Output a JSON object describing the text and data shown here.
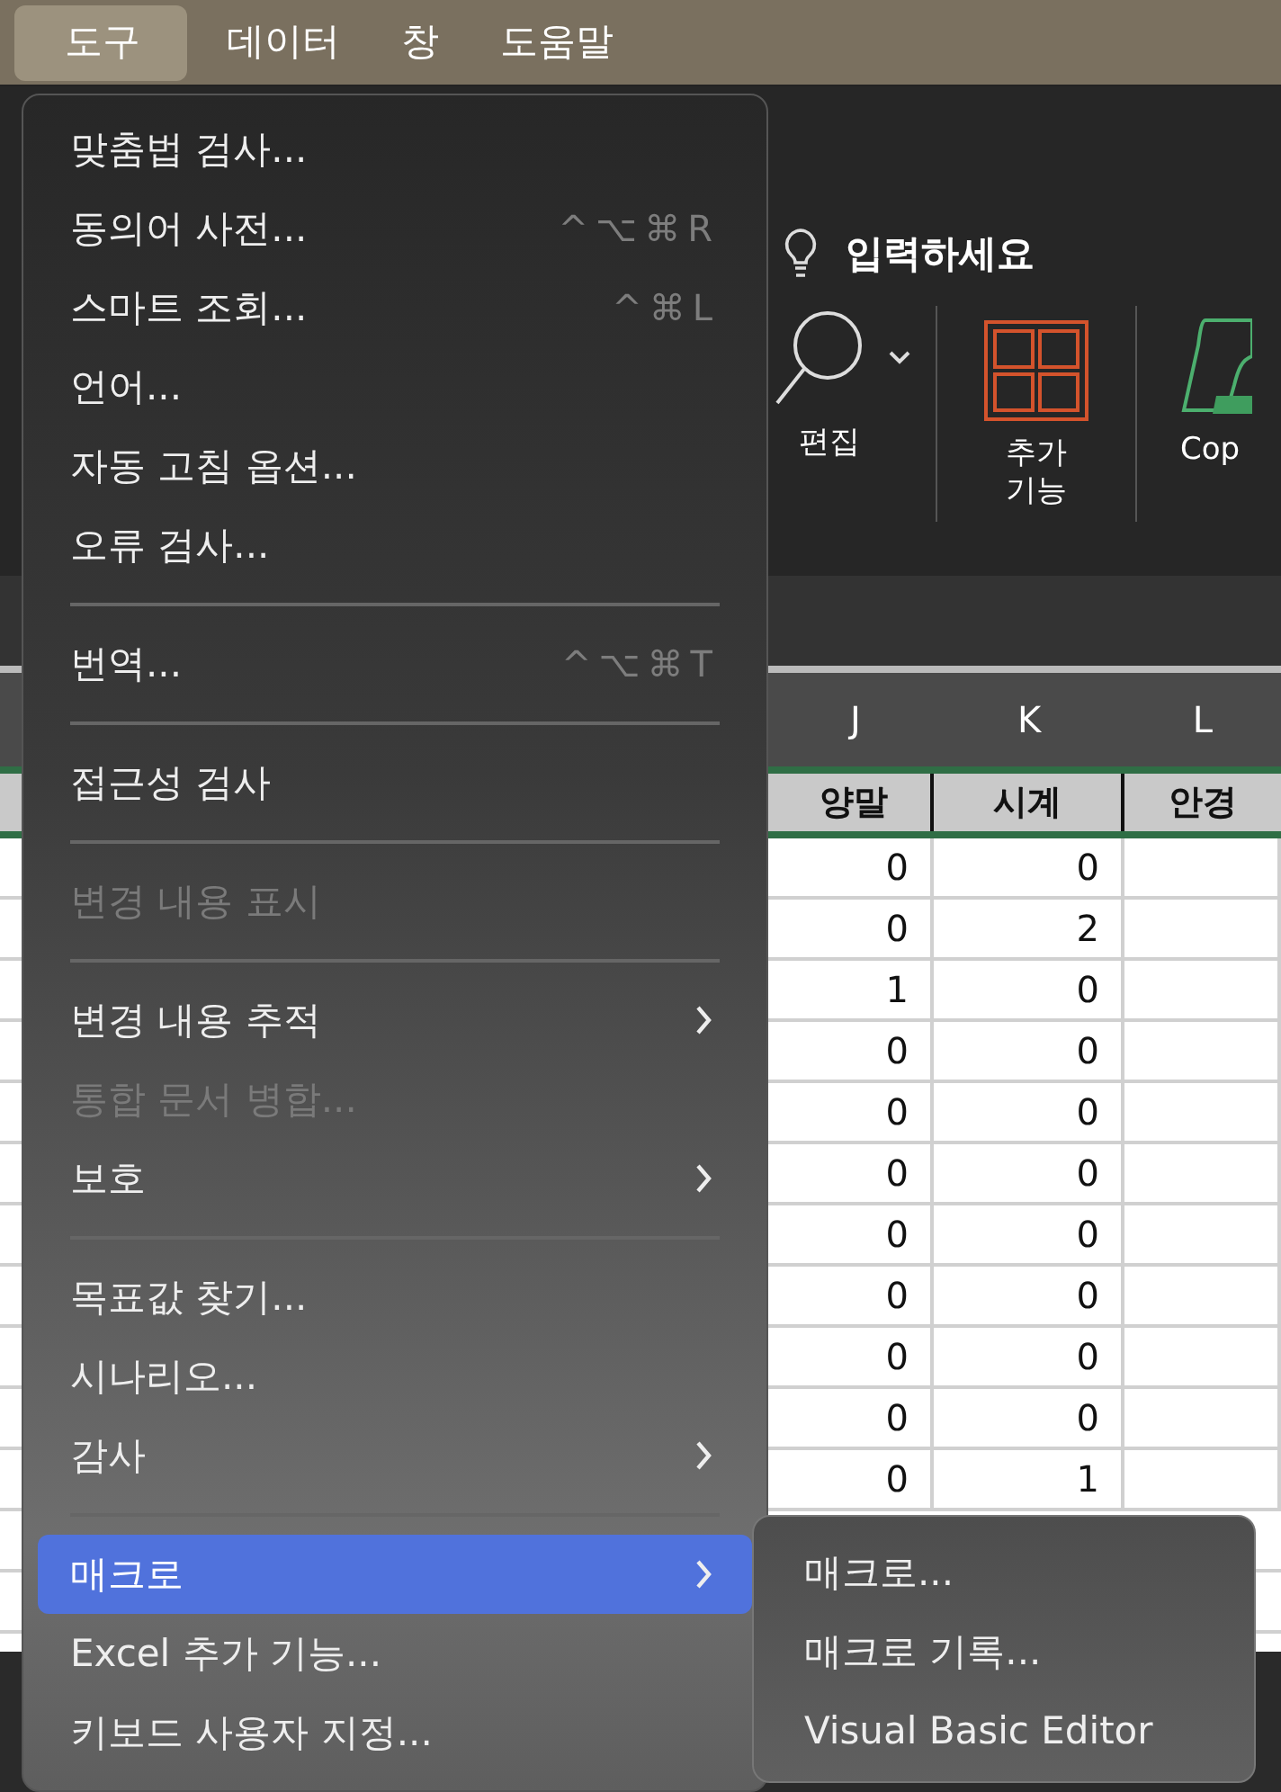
{
  "menu_bar": [
    {
      "label": "도구",
      "selected": true
    },
    {
      "label": "데이터",
      "selected": false
    },
    {
      "label": "창",
      "selected": false
    },
    {
      "label": "도움말",
      "selected": false
    }
  ],
  "ribbon": {
    "search_hint": "입력하세요",
    "groups": [
      {
        "kind": "find",
        "label": "편집"
      },
      {
        "kind": "addins",
        "label": "추가 기능"
      },
      {
        "kind": "copilot",
        "label": "Cop"
      }
    ]
  },
  "sheet": {
    "column_letters": [
      "J",
      "K",
      "L"
    ],
    "header_cells": [
      "양말",
      "시계",
      "안경"
    ],
    "rows": [
      [
        "0",
        "0"
      ],
      [
        "0",
        "2"
      ],
      [
        "1",
        "0"
      ],
      [
        "0",
        "0"
      ],
      [
        "0",
        "0"
      ],
      [
        "0",
        "0"
      ],
      [
        "0",
        "0"
      ],
      [
        "0",
        "0"
      ],
      [
        "0",
        "0"
      ],
      [
        "0",
        "0"
      ],
      [
        "0",
        "1"
      ]
    ]
  },
  "menu": {
    "items": [
      {
        "kind": "item",
        "label": "맞춤법 검사...",
        "disabled": false,
        "selected": false,
        "submenu": false
      },
      {
        "kind": "item",
        "label": "동의어 사전...",
        "shortcut": "^⌥⌘R",
        "disabled": false,
        "selected": false,
        "submenu": false
      },
      {
        "kind": "item",
        "label": "스마트 조회...",
        "shortcut": "^⌘L",
        "disabled": false,
        "selected": false,
        "submenu": false
      },
      {
        "kind": "item",
        "label": "언어...",
        "disabled": false,
        "selected": false,
        "submenu": false
      },
      {
        "kind": "item",
        "label": "자동 고침 옵션...",
        "disabled": false,
        "selected": false,
        "submenu": false
      },
      {
        "kind": "item",
        "label": "오류 검사...",
        "disabled": false,
        "selected": false,
        "submenu": false
      },
      {
        "kind": "separator"
      },
      {
        "kind": "item",
        "label": "번역...",
        "shortcut": "^⌥⌘T",
        "disabled": false,
        "selected": false,
        "submenu": false
      },
      {
        "kind": "separator"
      },
      {
        "kind": "item",
        "label": "접근성 검사",
        "disabled": false,
        "selected": false,
        "submenu": false
      },
      {
        "kind": "separator"
      },
      {
        "kind": "item",
        "label": "변경 내용 표시",
        "disabled": true,
        "selected": false,
        "submenu": false
      },
      {
        "kind": "separator"
      },
      {
        "kind": "item",
        "label": "변경 내용 추적",
        "disabled": false,
        "selected": false,
        "submenu": true
      },
      {
        "kind": "item",
        "label": "통합 문서 병합...",
        "disabled": true,
        "selected": false,
        "submenu": false
      },
      {
        "kind": "item",
        "label": "보호",
        "disabled": false,
        "selected": false,
        "submenu": true
      },
      {
        "kind": "separator"
      },
      {
        "kind": "item",
        "label": "목표값 찾기...",
        "disabled": false,
        "selected": false,
        "submenu": false
      },
      {
        "kind": "item",
        "label": "시나리오...",
        "disabled": false,
        "selected": false,
        "submenu": false
      },
      {
        "kind": "item",
        "label": "감사",
        "disabled": false,
        "selected": false,
        "submenu": true
      },
      {
        "kind": "separator"
      },
      {
        "kind": "item",
        "label": "매크로",
        "disabled": false,
        "selected": true,
        "submenu": true
      },
      {
        "kind": "item",
        "label": "Excel 추가 기능...",
        "disabled": false,
        "selected": false,
        "submenu": false
      },
      {
        "kind": "item",
        "label": "키보드 사용자 지정...",
        "disabled": false,
        "selected": false,
        "submenu": false
      }
    ]
  },
  "submenu": {
    "items": [
      "매크로...",
      "매크로 기록...",
      "Visual Basic Editor"
    ]
  }
}
